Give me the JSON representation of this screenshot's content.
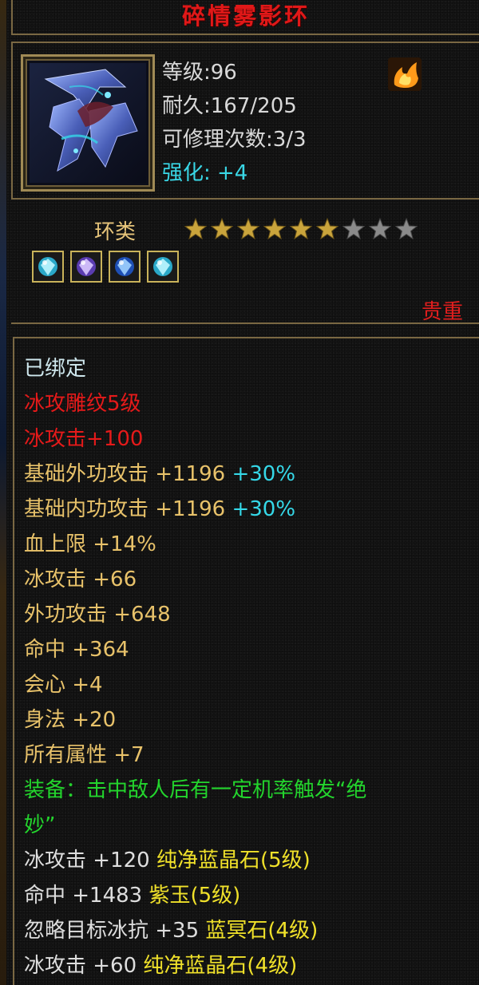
{
  "item": {
    "name": "碎情雾影环",
    "stats": {
      "level_label": "等级:96",
      "durability_label": "耐久:167/205",
      "repair_label": "可修理次数:3/3",
      "enhance_label": "强化: +4"
    },
    "category": "环类",
    "stars": {
      "filled": 6,
      "total": 9
    },
    "gems": [
      "cyan-gem-icon",
      "purple-gem-icon",
      "blue-gem-icon",
      "cyan-gem-icon"
    ],
    "rarity": "贵重"
  },
  "attributes": {
    "bound": "已绑定",
    "engrave": "冰攻雕纹5级",
    "ice_attack_bonus": "冰攻击+100",
    "base_outer": {
      "label": "基础外功攻击 +1196",
      "pct": "+30%"
    },
    "base_inner": {
      "label": "基础内功攻击 +1196",
      "pct": "+30%"
    },
    "hp": "血上限 +14%",
    "ice_attack": "冰攻击 +66",
    "outer_attack": "外功攻击 +648",
    "hit": "命中 +364",
    "crit": "会心 +4",
    "agility": "身法 +20",
    "all_attr": "所有属性 +7",
    "equip_effect_1": "装备：击中敌人后有一定机率触发“绝",
    "equip_effect_2": "妙”",
    "gem_lines": [
      {
        "stat": "冰攻击 +120",
        "gem": "纯净蓝晶石(5级)"
      },
      {
        "stat": "命中 +1483",
        "gem": "紫玉(5级)"
      },
      {
        "stat": "忽略目标冰抗 +35",
        "gem": "蓝冥石(4级)"
      },
      {
        "stat": "冰攻击 +60",
        "gem": "纯净蓝晶石(4级)"
      }
    ]
  },
  "colors": {
    "title_red": "#e01818",
    "enhance_cyan": "#39d7e6",
    "gold_text": "#e8c26a",
    "green_text": "#23d52d",
    "gem_yellow": "#f0e12a",
    "border_bronze": "#7a6843"
  }
}
